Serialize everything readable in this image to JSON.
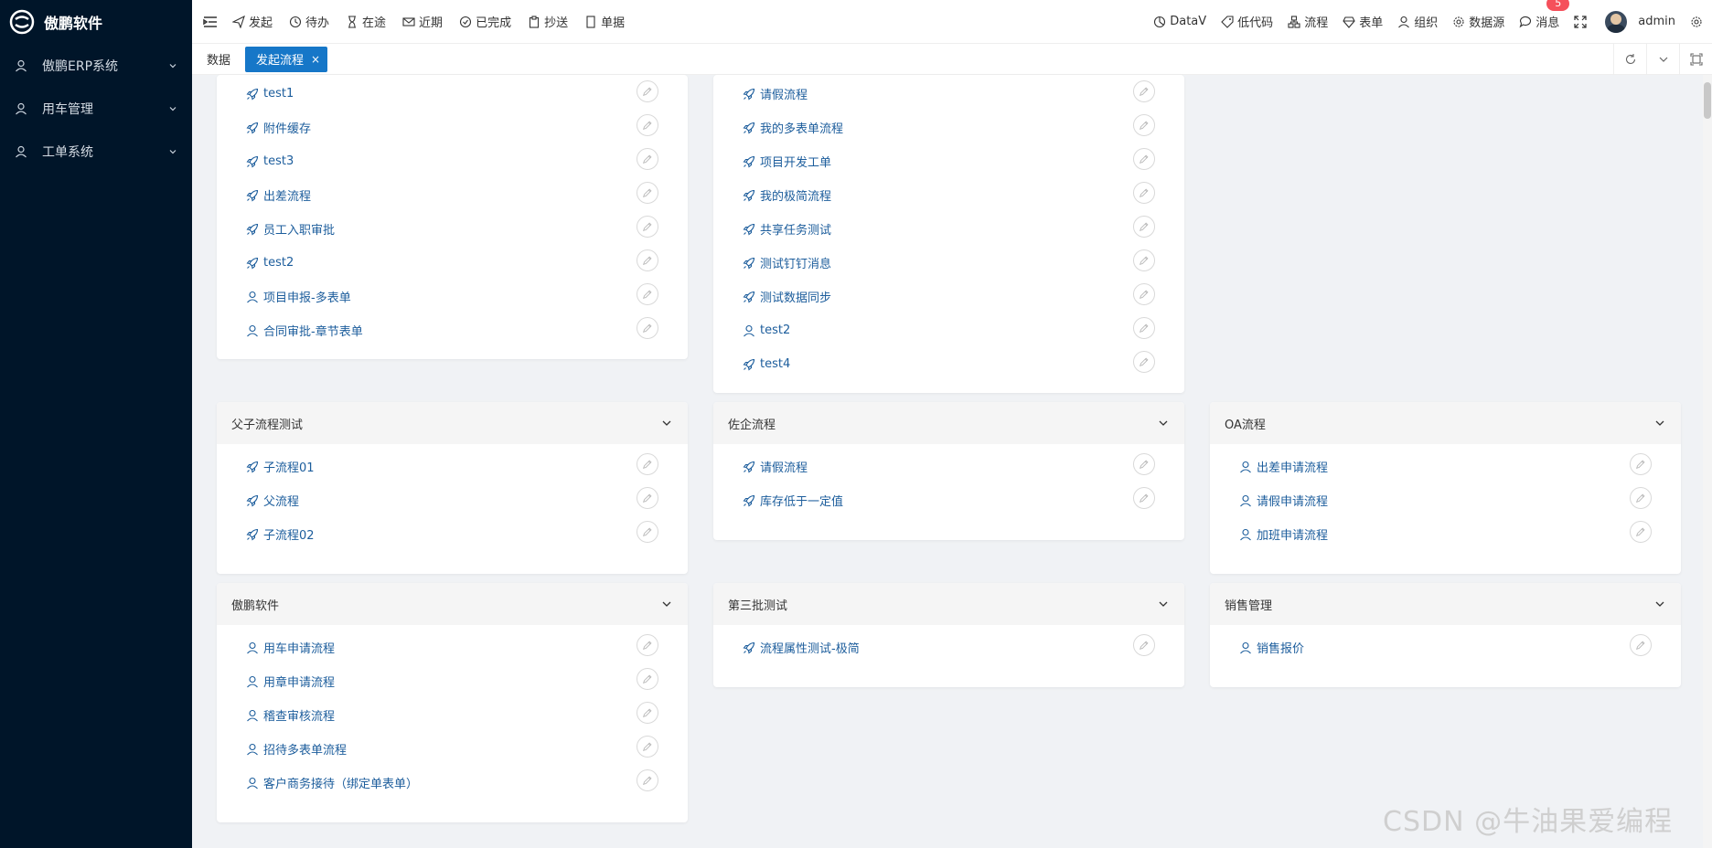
{
  "brand": {
    "name": "傲鹏软件"
  },
  "sidebar": {
    "items": [
      {
        "label": "傲鹏ERP系统"
      },
      {
        "label": "用车管理"
      },
      {
        "label": "工单系统"
      }
    ]
  },
  "header": {
    "quick": [
      {
        "label": "发起",
        "icon": "send-icon"
      },
      {
        "label": "待办",
        "icon": "clock-icon"
      },
      {
        "label": "在途",
        "icon": "hourglass-icon"
      },
      {
        "label": "近期",
        "icon": "mail-icon"
      },
      {
        "label": "已完成",
        "icon": "check-circle-icon"
      },
      {
        "label": "抄送",
        "icon": "clipboard-icon"
      },
      {
        "label": "单据",
        "icon": "document-icon"
      }
    ],
    "right": [
      {
        "label": "DataV",
        "icon": "chart-icon"
      },
      {
        "label": "低代码",
        "icon": "tag-icon"
      },
      {
        "label": "流程",
        "icon": "flow-icon"
      },
      {
        "label": "表单",
        "icon": "diamond-icon"
      },
      {
        "label": "组织",
        "icon": "user-icon"
      },
      {
        "label": "数据源",
        "icon": "gear-icon"
      },
      {
        "label": "消息",
        "icon": "chat-icon"
      }
    ],
    "message_badge": "5",
    "user": "admin"
  },
  "tabs": [
    {
      "label": "数据"
    },
    {
      "label": "发起流程",
      "close": "×"
    }
  ],
  "cards": {
    "top_left": {
      "items": [
        "test1",
        "附件缓存",
        "test3",
        "出差流程",
        "员工入职审批",
        "test2",
        "项目申报-多表单",
        "合同审批-章节表单"
      ]
    },
    "top_mid": {
      "items": [
        "请假流程",
        "我的多表单流程",
        "项目开发工单",
        "我的极简流程",
        "共享任务测试",
        "测试钉钉消息",
        "测试数据同步",
        "test2",
        "test4"
      ]
    },
    "fuzi": {
      "title": "父子流程测试",
      "items": [
        "子流程01",
        "父流程",
        "子流程02"
      ]
    },
    "zuoqi": {
      "title": "佐企流程",
      "items": [
        "请假流程",
        "库存低于一定值"
      ]
    },
    "oa": {
      "title": "OA流程",
      "items": [
        "出差申请流程",
        "请假申请流程",
        "加班申请流程"
      ]
    },
    "aopeng": {
      "title": "傲鹏软件",
      "items": [
        "用车申请流程",
        "用章申请流程",
        "稽查审核流程",
        "招待多表单流程",
        "客户商务接待（绑定单表单）"
      ]
    },
    "disanpi": {
      "title": "第三批测试",
      "items": [
        "流程属性测试-极简"
      ]
    },
    "xiaoshou": {
      "title": "销售管理",
      "items": [
        "销售报价"
      ]
    }
  },
  "watermark": "CSDN @牛油果爱编程"
}
